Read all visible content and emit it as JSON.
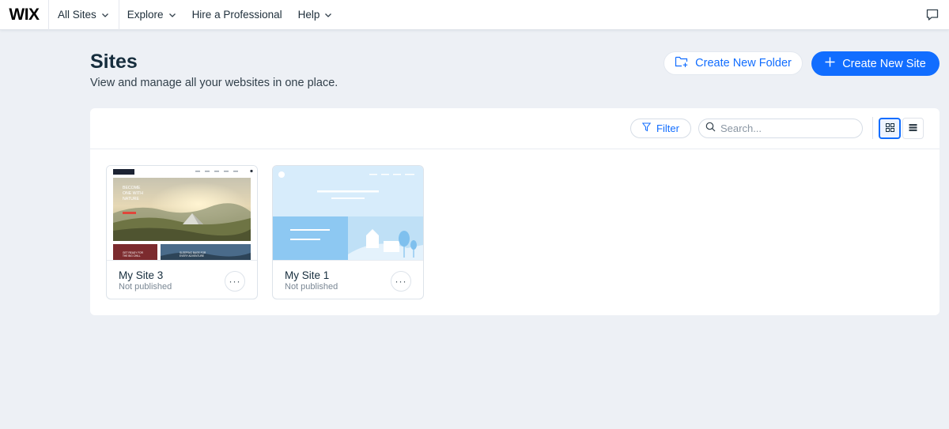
{
  "nav": {
    "logo": "WIX",
    "items": [
      {
        "label": "All Sites"
      },
      {
        "label": "Explore"
      },
      {
        "label": "Hire a Professional"
      },
      {
        "label": "Help"
      }
    ]
  },
  "header": {
    "title": "Sites",
    "subtitle": "View and manage all your websites in one place.",
    "create_folder_label": "Create New Folder",
    "create_site_label": "Create New Site"
  },
  "toolbar": {
    "filter_label": "Filter",
    "search_placeholder": "Search..."
  },
  "sites": [
    {
      "name": "My Site 3",
      "status": "Not published",
      "thumb_text": {
        "hero": "BECOME ONE WITH NATURE",
        "caption_left": "GET READY FOR THE BIG CHILL",
        "caption_right": "SLEEPING BAGS FOR EVERY ADVENTURE"
      }
    },
    {
      "name": "My Site 1",
      "status": "Not published"
    }
  ],
  "colors": {
    "accent": "#116dff",
    "page_bg": "#edf0f5",
    "text_primary": "#162d3d",
    "text_secondary": "#7a8794"
  }
}
